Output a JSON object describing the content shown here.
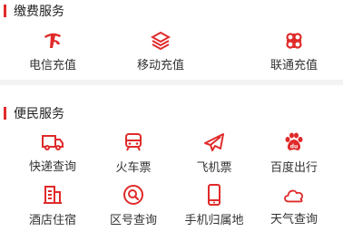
{
  "accent_color": "#e02a2a",
  "payment": {
    "title": "缴费服务",
    "items": [
      {
        "label": "电信充值",
        "icon": "china-telecom-icon"
      },
      {
        "label": "移动充值",
        "icon": "china-mobile-icon"
      },
      {
        "label": "联通充值",
        "icon": "china-unicom-icon"
      }
    ]
  },
  "convenience": {
    "title": "便民服务",
    "items": [
      {
        "label": "快递查询",
        "icon": "delivery-truck-icon"
      },
      {
        "label": "火车票",
        "icon": "train-icon"
      },
      {
        "label": "飞机票",
        "icon": "airplane-icon"
      },
      {
        "label": "百度出行",
        "icon": "baidu-paw-icon"
      },
      {
        "label": "酒店住宿",
        "icon": "hotel-building-icon"
      },
      {
        "label": "区号查询",
        "icon": "magnifier-icon"
      },
      {
        "label": "手机归属地",
        "icon": "mobile-phone-icon"
      },
      {
        "label": "天气查询",
        "icon": "cloud-icon"
      }
    ]
  }
}
